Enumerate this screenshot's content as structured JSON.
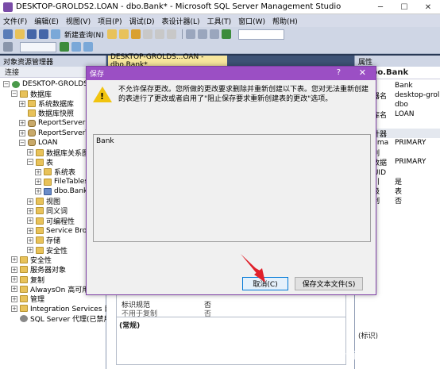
{
  "window": {
    "title": "DESKTOP-GROLDS2.LOAN - dbo.Bank* - Microsoft SQL Server Management Studio",
    "minimize": "─",
    "maximize": "☐",
    "close": "✕"
  },
  "menu": [
    "文件(F)",
    "编辑(E)",
    "视图(V)",
    "项目(P)",
    "调试(D)",
    "表设计器(L)",
    "工具(T)",
    "窗口(W)",
    "帮助(H)"
  ],
  "toolbar": {
    "new_query": "新建查询(N)"
  },
  "object_explorer": {
    "title": "对象资源管理器",
    "connect": "连接",
    "nodes": [
      {
        "label": "DESKTOP-GROLDS2",
        "exp": "⊟",
        "icon": "server",
        "indent": 0
      },
      {
        "label": "数据库",
        "exp": "⊟",
        "icon": "folder",
        "indent": 1
      },
      {
        "label": "系统数据库",
        "exp": "⊞",
        "icon": "folder",
        "indent": 2
      },
      {
        "label": "数据库快照",
        "exp": "",
        "icon": "folder",
        "indent": 2
      },
      {
        "label": "ReportServer",
        "exp": "⊞",
        "icon": "db",
        "indent": 2
      },
      {
        "label": "ReportServerTe",
        "exp": "⊞",
        "icon": "db",
        "indent": 2
      },
      {
        "label": "LOAN",
        "exp": "⊟",
        "icon": "db",
        "indent": 2
      },
      {
        "label": "数据库关系图",
        "exp": "⊞",
        "icon": "folder",
        "indent": 3
      },
      {
        "label": "表",
        "exp": "⊟",
        "icon": "folder",
        "indent": 3
      },
      {
        "label": "系统表",
        "exp": "⊞",
        "icon": "folder",
        "indent": 4
      },
      {
        "label": "FileTables",
        "exp": "⊞",
        "icon": "folder",
        "indent": 4
      },
      {
        "label": "dbo.Bank",
        "exp": "⊞",
        "icon": "table",
        "indent": 4
      },
      {
        "label": "视图",
        "exp": "⊞",
        "icon": "folder",
        "indent": 3
      },
      {
        "label": "同义词",
        "exp": "⊞",
        "icon": "folder",
        "indent": 3
      },
      {
        "label": "可编程性",
        "exp": "⊞",
        "icon": "folder",
        "indent": 3
      },
      {
        "label": "Service Broke",
        "exp": "⊞",
        "icon": "folder",
        "indent": 3
      },
      {
        "label": "存储",
        "exp": "⊞",
        "icon": "folder",
        "indent": 3
      },
      {
        "label": "安全性",
        "exp": "⊞",
        "icon": "folder",
        "indent": 3
      },
      {
        "label": "安全性",
        "exp": "⊞",
        "icon": "folder",
        "indent": 1
      },
      {
        "label": "服务器对象",
        "exp": "⊞",
        "icon": "folder",
        "indent": 1
      },
      {
        "label": "复制",
        "exp": "⊞",
        "icon": "folder",
        "indent": 1
      },
      {
        "label": "AlwaysOn 高可用性",
        "exp": "⊞",
        "icon": "folder",
        "indent": 1
      },
      {
        "label": "管理",
        "exp": "⊞",
        "icon": "folder",
        "indent": 1
      },
      {
        "label": "Integration Services 目录",
        "exp": "⊞",
        "icon": "folder",
        "indent": 1
      },
      {
        "label": "SQL Server 代理(已禁用代",
        "exp": "",
        "icon": "agent",
        "indent": 1
      }
    ]
  },
  "editor": {
    "tab_label": "DESKTOP-GROLDS...OAN - dbo.Bank*",
    "col_props": [
      {
        "k": "标识规范",
        "v": "否"
      },
      {
        "k": "不用于复制",
        "v": "否"
      }
    ],
    "general": "(常规)"
  },
  "properties": {
    "title": "属性",
    "object": "dbo.Bank",
    "rows": [
      {
        "k": "名称)",
        "v": "Bank",
        "cat": false
      },
      {
        "k": "服务器名",
        "v": "desktop-grol",
        "cat": false
      },
      {
        "k": "架构",
        "v": "dbo",
        "cat": false
      },
      {
        "k": "数据库名",
        "v": "LOAN",
        "cat": false
      },
      {
        "k": "说明",
        "v": "",
        "cat": false
      },
      {
        "k": "表设计器",
        "v": "",
        "cat": true
      },
      {
        "k": "Text/Ima",
        "v": "PRIMARY",
        "cat": false
      },
      {
        "k": "标识列",
        "v": "",
        "cat": false
      },
      {
        "k": "常规数据",
        "v": "PRIMARY",
        "cat": false
      },
      {
        "k": "行 GUID",
        "v": "",
        "cat": false
      },
      {
        "k": "可索引",
        "v": "是",
        "cat": false
      },
      {
        "k": "锁升级",
        "v": "表",
        "cat": false
      },
      {
        "k": "已复制",
        "v": "否",
        "cat": false
      }
    ],
    "footer": "(标识)"
  },
  "dialog": {
    "title": "保存",
    "help": "?",
    "close": "✕",
    "message": "不允许保存更改。您所做的更改要求删除并重新创建以下表。您对无法重新创建的表进行了更改或者启用了\"阻止保存要求重新创建表的更改\"选项。",
    "list_item": "Bank",
    "cancel": "取消(C)",
    "save_text": "保存文本文件(S)"
  },
  "watermark": "https://blog.csdn.net/weixin_44949135",
  "colors": {
    "accent": "#9b4fc4",
    "arrow": "#e0202a"
  }
}
